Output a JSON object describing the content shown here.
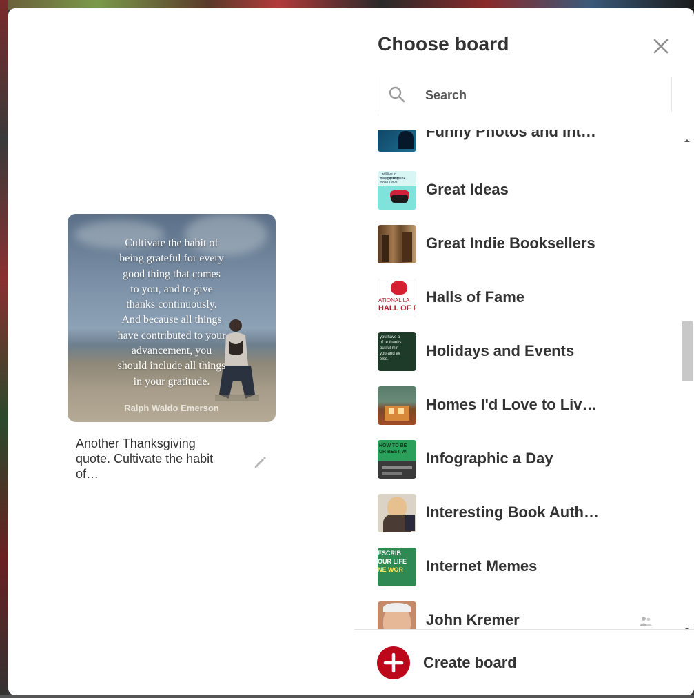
{
  "dialog": {
    "title": "Choose board"
  },
  "search": {
    "placeholder": "Search"
  },
  "pin": {
    "quote_lines": [
      "Cultivate the habit of",
      "being grateful for every",
      "good thing that comes",
      "to you, and to give",
      "thanks continuously.",
      "And because all things",
      "have contributed to your",
      "advancement, you",
      "should include all things",
      "in your gratitude."
    ],
    "author": "Ralph Waldo Emerson",
    "description_lines": [
      "Another Thanksgiving",
      "quote. Cultivate the habit",
      "of…"
    ]
  },
  "boards": [
    {
      "name": "Funny Photos and Int…",
      "thumb_colors": [
        "#0e3b5c",
        "#1c6f8f"
      ]
    },
    {
      "name": "Great Ideas",
      "thumb_colors": [
        "#5fd6cf",
        "#c9f1ee"
      ],
      "thumb_text": [
        "I will live in thanksgiving",
        "may get to thank",
        "those I love"
      ]
    },
    {
      "name": "Great Indie Booksellers",
      "thumb_colors": [
        "#5a3b22",
        "#a2784f"
      ]
    },
    {
      "name": "Halls of Fame",
      "thumb_colors": [
        "#ffffff",
        "#e8e8e8"
      ],
      "thumb_text": [
        "ATIONAL LA",
        "HALL OF F"
      ]
    },
    {
      "name": "Holidays and Events",
      "thumb_colors": [
        "#1e3b2a",
        "#2f5a3a"
      ],
      "thumb_text": [
        "you have a",
        "of re thanks",
        "outiful mir",
        "you-and ev",
        "else."
      ]
    },
    {
      "name": "Homes I'd Love to Liv…",
      "thumb_colors": [
        "#5a7c6a",
        "#9a4a2a"
      ]
    },
    {
      "name": "Infographic a Day",
      "thumb_colors": [
        "#2aa05a",
        "#3a3a3a"
      ],
      "thumb_text": [
        "HOW TO BE",
        "UR BEST WI"
      ]
    },
    {
      "name": "Interesting Book Auth…",
      "thumb_colors": [
        "#dcd3c7",
        "#6c5c4c"
      ]
    },
    {
      "name": "Internet Memes",
      "thumb_colors": [
        "#3a9a5a",
        "#1a6a3a"
      ],
      "thumb_text": [
        "ESCRIB",
        "OUR LIFE",
        "NE WOR"
      ]
    },
    {
      "name": "John Kremer",
      "thumb_colors": [
        "#a35a3a",
        "#e0b090"
      ],
      "collab": true
    }
  ],
  "footer": {
    "create_label": "Create board"
  },
  "colors": {
    "accent_red": "#bd081c",
    "text_dark": "#333333"
  }
}
